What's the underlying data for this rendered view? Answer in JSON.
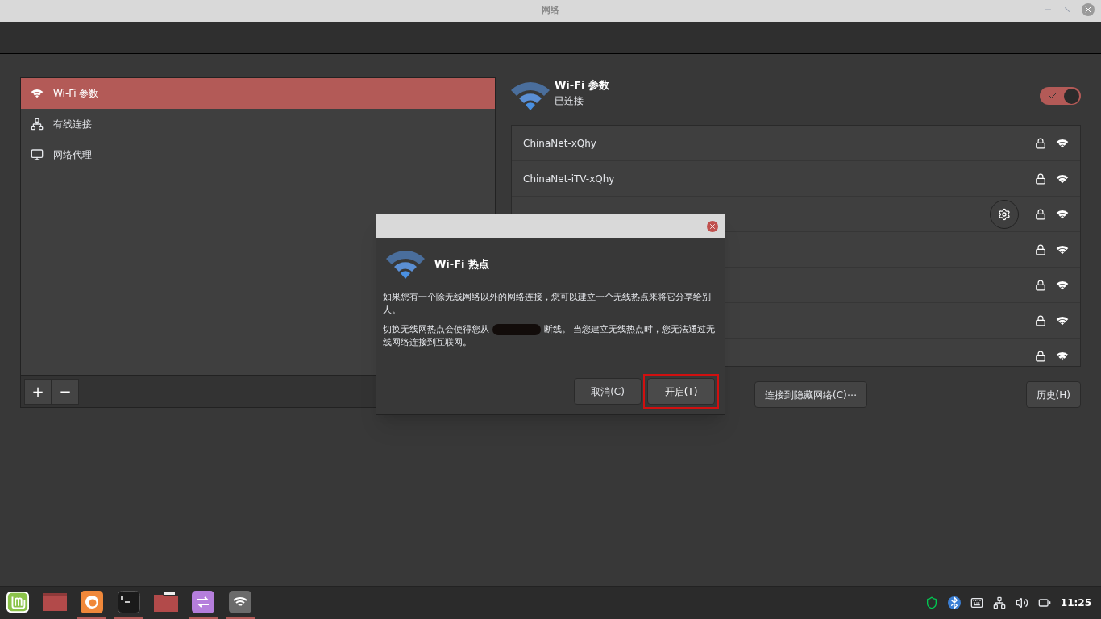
{
  "window": {
    "title": "网络"
  },
  "sidebar": {
    "items": [
      {
        "label": "Wi-Fi 参数",
        "kind": "wifi",
        "selected": true
      },
      {
        "label": "有线连接",
        "kind": "wired",
        "selected": false
      },
      {
        "label": "网络代理",
        "kind": "proxy",
        "selected": false
      }
    ],
    "buttons": [
      "+",
      "−"
    ]
  },
  "header": {
    "title": "Wi-Fi 参数",
    "status": "已连接",
    "on": true
  },
  "networks": [
    {
      "name": "ChinaNet-xQhy",
      "connected": false
    },
    {
      "name": "ChinaNet-iTV-xQhy",
      "connected": false
    },
    {
      "connected": true
    },
    {
      "connected": false
    },
    {
      "connected": false
    },
    {
      "connected": false
    },
    {
      "connected": false
    }
  ],
  "bottom_buttons": {
    "hidden": "连接到隐藏网络(C)⋯",
    "history": "历史(H)"
  },
  "dialog": {
    "title": "Wi-Fi 热点",
    "paragraph_1": "如果您有一个除无线网络以外的网络连接，您可以建立一个无线热点来将它分享给别人。",
    "paragraph_2_before": "切换无线网热点会使得您从",
    "paragraph_2_after": "断线。 当您建立无线热点时，您无法通过无线网络连接到互联网。",
    "cancel": "取消(C)",
    "confirm": "开启(T)"
  },
  "taskbar": {
    "apps": [
      {
        "kind": "mint",
        "running": false
      },
      {
        "kind": "desktop",
        "running": false
      },
      {
        "kind": "firefox",
        "running": true
      },
      {
        "kind": "terminal",
        "running": true
      },
      {
        "kind": "folder",
        "running": false
      },
      {
        "kind": "transfer",
        "running": true
      },
      {
        "kind": "wifi",
        "running": true
      }
    ],
    "clock": "11:25"
  }
}
